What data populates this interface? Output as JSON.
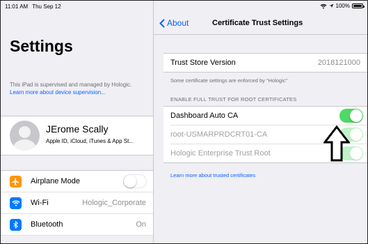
{
  "status_bar": {
    "time": "11:01 AM",
    "date": "Thu Sep 12",
    "battery": "100%",
    "battery_level": 1.0
  },
  "sidebar": {
    "title": "Settings",
    "supervision_text": "This iPad is supervised and managed by Hologic. ",
    "supervision_link": "Learn more about device supervision...",
    "profile": {
      "name": "JErome Scally",
      "subtitle": "Apple ID, iCloud, iTunes & App St..."
    },
    "items": [
      {
        "label": "Airplane Mode",
        "icon": "airplane-icon",
        "color": "#ff9500",
        "type": "toggle",
        "on": false
      },
      {
        "label": "Wi-Fi",
        "icon": "wifi-icon",
        "color": "#007aff",
        "value": "Hologic_Corporate"
      },
      {
        "label": "Bluetooth",
        "icon": "bluetooth-icon",
        "color": "#007aff",
        "value": "On"
      }
    ]
  },
  "detail": {
    "back_label": "About",
    "title": "Certificate Trust Settings",
    "trust_store": {
      "label": "Trust Store Version",
      "value": "2018121000"
    },
    "enforced_note": "Some certificate settings are enforced by “Hologic”",
    "section_header": "ENABLE FULL TRUST FOR ROOT CERTIFICATES",
    "certificates": [
      {
        "label": "Dashboard Auto CA",
        "on": true,
        "enabled": true
      },
      {
        "label": "root-USMARPRDCRT01-CA",
        "on": true,
        "enabled": false
      },
      {
        "label": "Hologic Enterprise Trust Root",
        "on": true,
        "enabled": false
      }
    ],
    "learn_more": "Learn more about trusted certificates"
  },
  "colors": {
    "accent": "#0a60ff",
    "toggle_on": "#4cd964",
    "background": "#efeff4"
  }
}
